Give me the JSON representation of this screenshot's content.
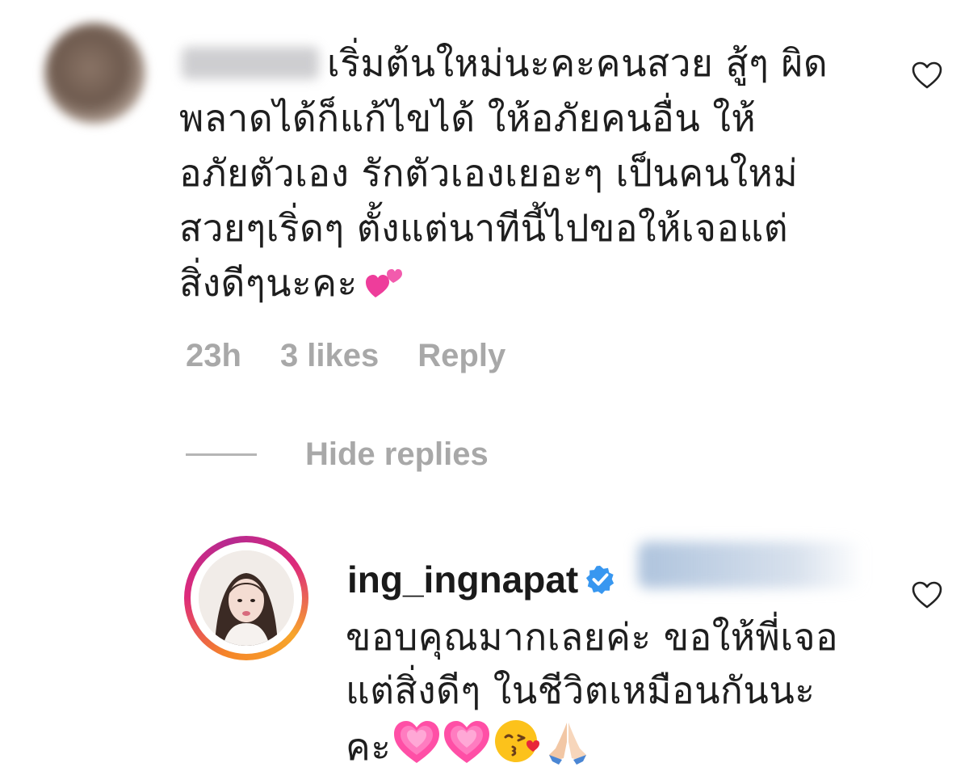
{
  "comment": {
    "text_lines": [
      "เริ่มต้นใหม่นะคะคนสวย สู้ๆ ผิด",
      "พลาดได้ก็แก้ไขได้ ให้อภัยคนอื่น ให้",
      "อภัยตัวเอง รักตัวเองเยอะๆ เป็นคนใหม่",
      "สวยๆเริ่ดๆ ตั้งแต่นาทีนี้ไปขอให้เจอแต่",
      "สิ่งดีๆนะคะ"
    ],
    "trailing_emoji": "two-hearts",
    "time": "23h",
    "likes": "3 likes",
    "reply_label": "Reply",
    "hide_replies_label": "Hide replies"
  },
  "reply": {
    "username": "ing_ingnapat",
    "verified": true,
    "text_lines": [
      "ขอบคุณมากเลยค่ะ ขอให้พี่เจอ",
      "แต่สิ่งดีๆ ในชีวิตเหมือนกันนะ",
      "คะ"
    ],
    "emojis": [
      "growing-heart",
      "growing-heart",
      "kissing-face",
      "folded-hands"
    ]
  },
  "colors": {
    "muted_text": "#a8a8a8",
    "verified_blue": "#3897f0",
    "story_ring_start": "#f58529",
    "story_ring_end": "#dd2a7b"
  }
}
